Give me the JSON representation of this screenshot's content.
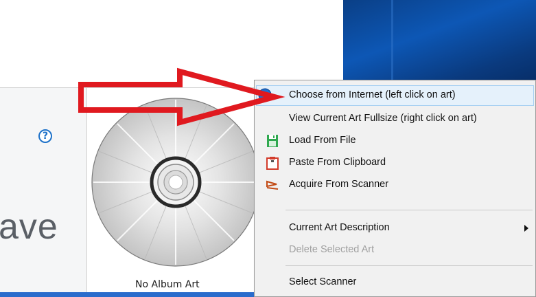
{
  "app": {
    "help_glyph": "?",
    "partial_text": "ave",
    "album_art_label": "No Album Art"
  },
  "menu": {
    "items": [
      {
        "label": "Choose from Internet (left click on art)",
        "icon": "globe-icon",
        "state": "highlighted"
      },
      {
        "label": "View Current Art Fullsize (right click on art)",
        "icon": "none",
        "state": "normal"
      },
      {
        "label": "Load From File",
        "icon": "floppy-disk-icon",
        "state": "normal"
      },
      {
        "label": "Paste From Clipboard",
        "icon": "clipboard-icon",
        "state": "normal"
      },
      {
        "label": "Acquire From Scanner",
        "icon": "scanner-icon",
        "state": "normal"
      },
      {
        "label": "Current Art Description",
        "icon": "none",
        "state": "submenu"
      },
      {
        "label": "Delete Selected Art",
        "icon": "none",
        "state": "disabled"
      },
      {
        "label": "Select Scanner",
        "icon": "none",
        "state": "normal"
      }
    ]
  },
  "colors": {
    "arrow": "#e0191f",
    "highlight_bg": "#e5f1fb",
    "highlight_border": "#a6cff2",
    "disabled_text": "#a0a0a0",
    "taskbar_blue": "#2a6ccc"
  }
}
